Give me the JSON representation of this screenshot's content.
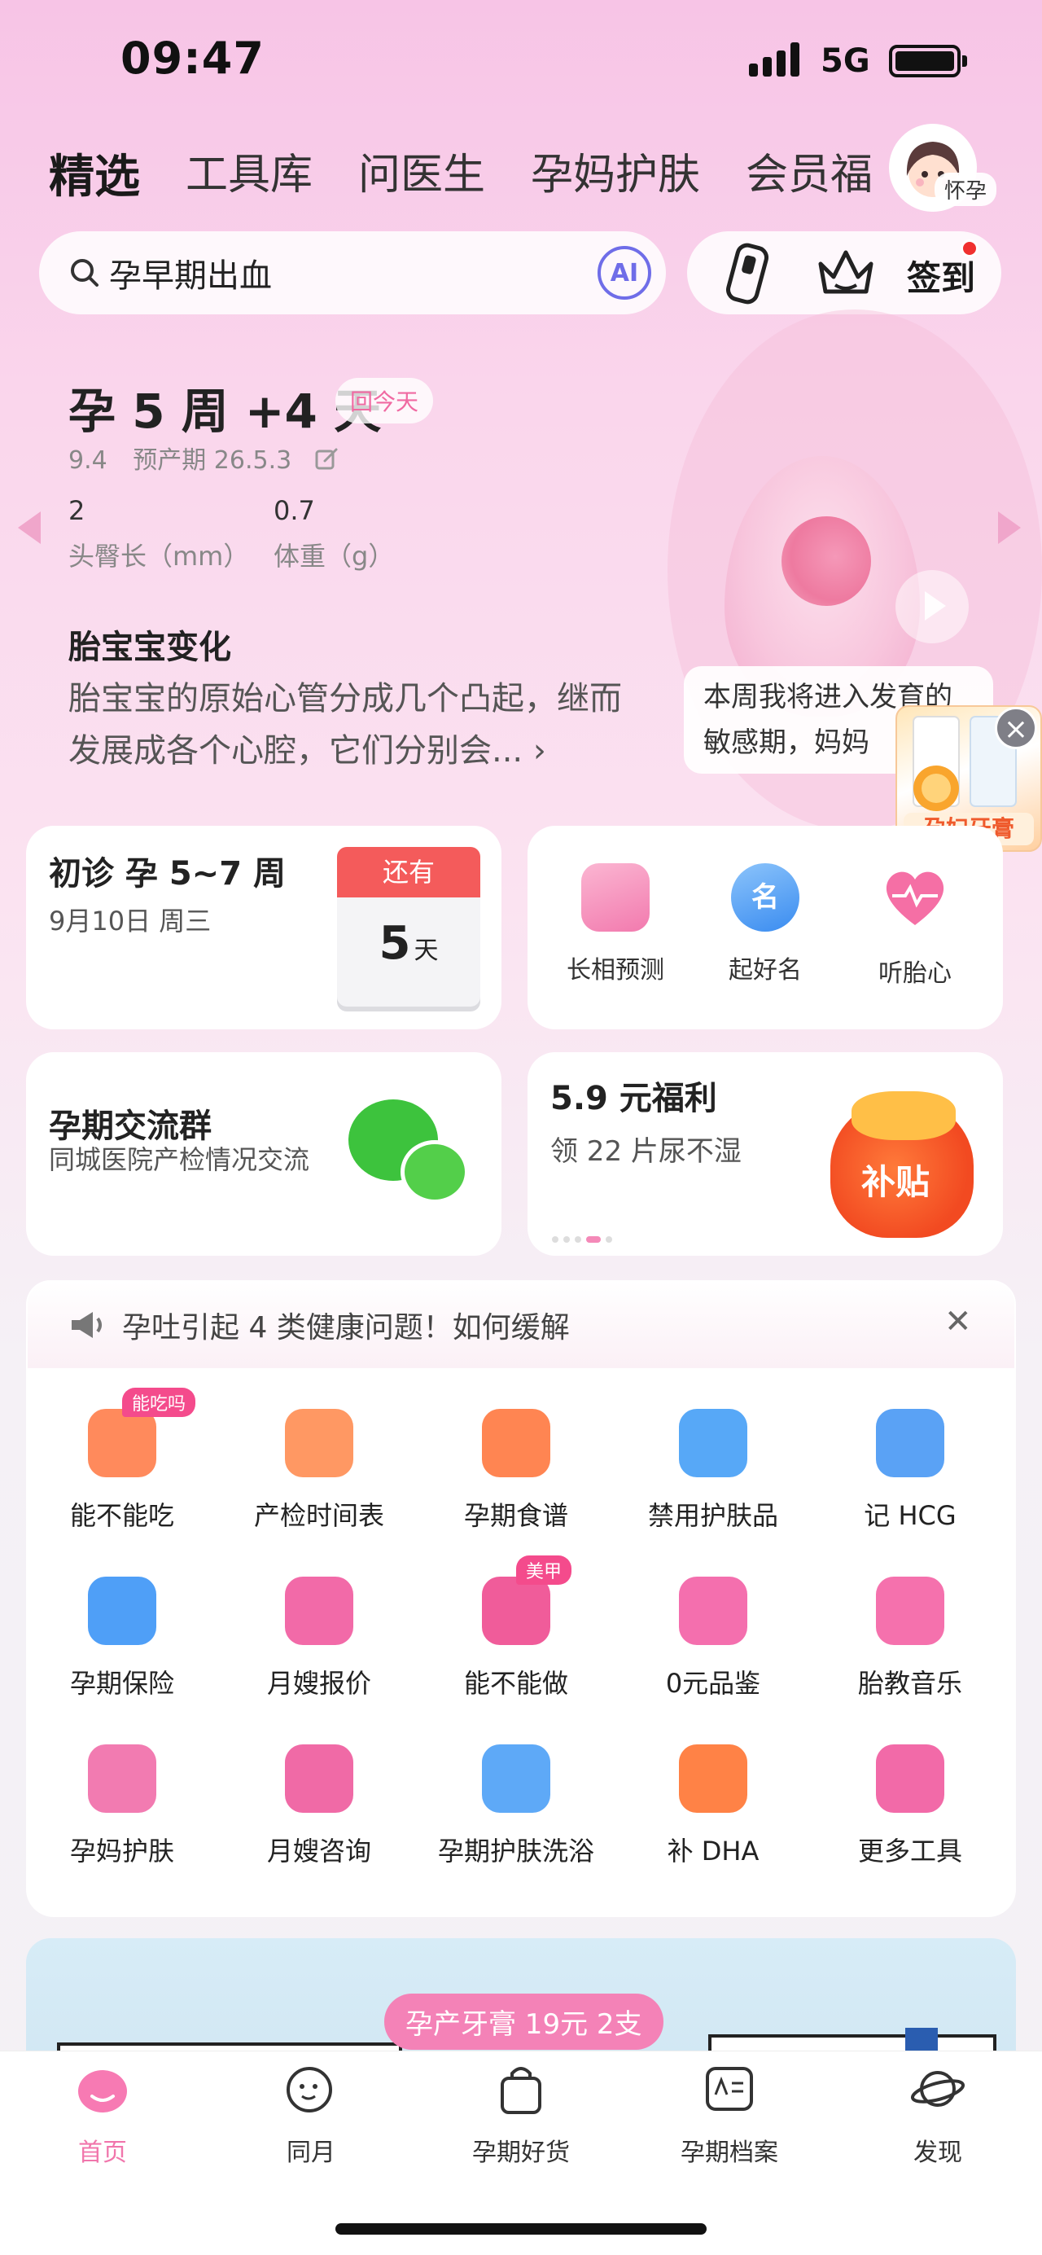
{
  "status_bar": {
    "time": "09:47",
    "network": "5G"
  },
  "tabs": [
    {
      "label": "精选",
      "active": true
    },
    {
      "label": "工具库"
    },
    {
      "label": "问医生"
    },
    {
      "label": "孕妈护肤"
    },
    {
      "label": "会员福"
    }
  ],
  "avatar": {
    "tag": "怀孕"
  },
  "search": {
    "placeholder": "孕早期出血",
    "ai_label": "AI"
  },
  "quick_actions": {
    "checkin_label": "签到"
  },
  "pregnancy": {
    "week_text": "孕 5 周 +4 天",
    "back_today": "回今天",
    "date": "9.4",
    "due_label": "预产期 26.5.3",
    "length_value": "2",
    "length_label": "头臀长（mm）",
    "weight_value": "0.7",
    "weight_label": "体重（g）",
    "change_title": "胎宝宝变化",
    "change_text": "胎宝宝的原始心管分成几个凸起，继而发展成各个心腔，它们分别会...",
    "bubble_text": "本周我将进入发育的敏感期，妈妈",
    "promo_label": "孕妇牙膏"
  },
  "visit_card": {
    "title": "初诊 孕 5~7 周",
    "date": "9月10日 周三",
    "countdown_head": "还有",
    "countdown_num": "5",
    "countdown_unit": "天"
  },
  "feature_card": {
    "items": [
      {
        "label": "长相预测",
        "icon": "face-box-icon",
        "color": "#f7a0c4"
      },
      {
        "label": "起好名",
        "icon": "name-icon",
        "color": "#4d9cf5"
      },
      {
        "label": "听胎心",
        "icon": "heart-icon",
        "color": "#f56fa5"
      }
    ]
  },
  "group_card": {
    "title": "孕期交流群",
    "subtitle": "同城医院产检情况交流"
  },
  "welfare_card": {
    "title": "5.9 元福利",
    "subtitle": "领 22 片尿不湿",
    "badge": "补贴"
  },
  "notice": {
    "text": "孕吐引起 4 类健康问题！如何缓解"
  },
  "tools": [
    {
      "label": "能不能吃",
      "icon": "food-icon",
      "color": "#ff8a5c",
      "tag": "能吃吗"
    },
    {
      "label": "产检时间表",
      "icon": "calendar-check-icon",
      "color": "#ff9863"
    },
    {
      "label": "孕期食谱",
      "icon": "dish-cover-icon",
      "color": "#ff8552"
    },
    {
      "label": "禁用护肤品",
      "icon": "lotion-bottle-icon",
      "color": "#57a8f7"
    },
    {
      "label": "记 HCG",
      "icon": "hcg-shield-icon",
      "color": "#5aa2f5"
    },
    {
      "label": "孕期保险",
      "icon": "insurance-shield-icon",
      "color": "#4f9ff7"
    },
    {
      "label": "月嫂报价",
      "icon": "nanny-icon",
      "color": "#f26aa8"
    },
    {
      "label": "能不能做",
      "icon": "nail-polish-icon",
      "color": "#f05c9a",
      "tag": "美甲"
    },
    {
      "label": "0元品鉴",
      "icon": "crown-badge-icon",
      "color": "#f46fae"
    },
    {
      "label": "胎教音乐",
      "icon": "music-note-icon",
      "color": "#f571ad"
    },
    {
      "label": "孕妈护肤",
      "icon": "skincare-woman-icon",
      "color": "#f27bb1"
    },
    {
      "label": "月嫂咨询",
      "icon": "nanny-chat-icon",
      "color": "#f06aa6"
    },
    {
      "label": "孕期护肤洗浴",
      "icon": "tube-icon",
      "color": "#5ea9f7"
    },
    {
      "label": "补 DHA",
      "icon": "fish-dha-icon",
      "color": "#ff8246"
    },
    {
      "label": "更多工具",
      "icon": "grid-more-icon",
      "color": "#f26aa8"
    }
  ],
  "banner": {
    "pill": "孕产牙膏 19元 2支"
  },
  "bottom_nav": [
    {
      "label": "首页",
      "icon": "home-icon",
      "active": true
    },
    {
      "label": "同月",
      "icon": "smile-face-icon"
    },
    {
      "label": "孕期好货",
      "icon": "shopping-bag-icon"
    },
    {
      "label": "孕期档案",
      "icon": "profile-card-icon"
    },
    {
      "label": "发现",
      "icon": "planet-icon"
    }
  ]
}
